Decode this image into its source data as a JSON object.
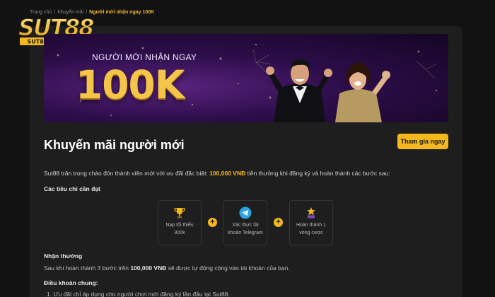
{
  "breadcrumb": {
    "home": "Trang chủ",
    "promotions": "Khuyến mãi",
    "current": "Người mới nhận ngay 100K",
    "separator": "/"
  },
  "logo": {
    "brand": "SUT88",
    "domain": "SUT88.FOOTBALL"
  },
  "banner": {
    "subtitle": "NGƯỜI MỚI NHẬN NGAY",
    "amount": "100K"
  },
  "promo": {
    "title": "Khuyến mãi người mới",
    "join_label": "Tham gia ngay",
    "intro_before": "Sut88 trân trọng chào đón thành viên mới với ưu đãi đặc biệt: ",
    "intro_highlight": "100,000 VNĐ",
    "intro_after": " tiền thưởng khi đăng ký và hoàn thành các bước sau:"
  },
  "criteria": {
    "title": "Các tiêu chí cần đạt",
    "steps": [
      {
        "icon": "trophy-icon",
        "label": "Nạp tối thiểu 300k"
      },
      {
        "icon": "telegram-icon",
        "label": "Xác thực tài khoản Telegram"
      },
      {
        "icon": "prize-icon",
        "label": "Hoàn thành 1 vòng cược"
      }
    ],
    "connector": "+"
  },
  "reward": {
    "title": "Nhận thưởng",
    "text_before": "Sau khi hoàn thành 3 bước trên ",
    "text_amount": "100,000 VNĐ",
    "text_after": " sẽ được tự động cộng vào tài khoản của bạn."
  },
  "terms": {
    "title": "Điều khoản chung:",
    "items": [
      "1. Ưu đãi chỉ áp dụng cho người chơi mới đăng ký lần đầu tại Sut88."
    ]
  },
  "colors": {
    "accent": "#f5b81c",
    "background": "#121212",
    "panel": "#1e1e1e",
    "banner": "#2c0d49"
  }
}
